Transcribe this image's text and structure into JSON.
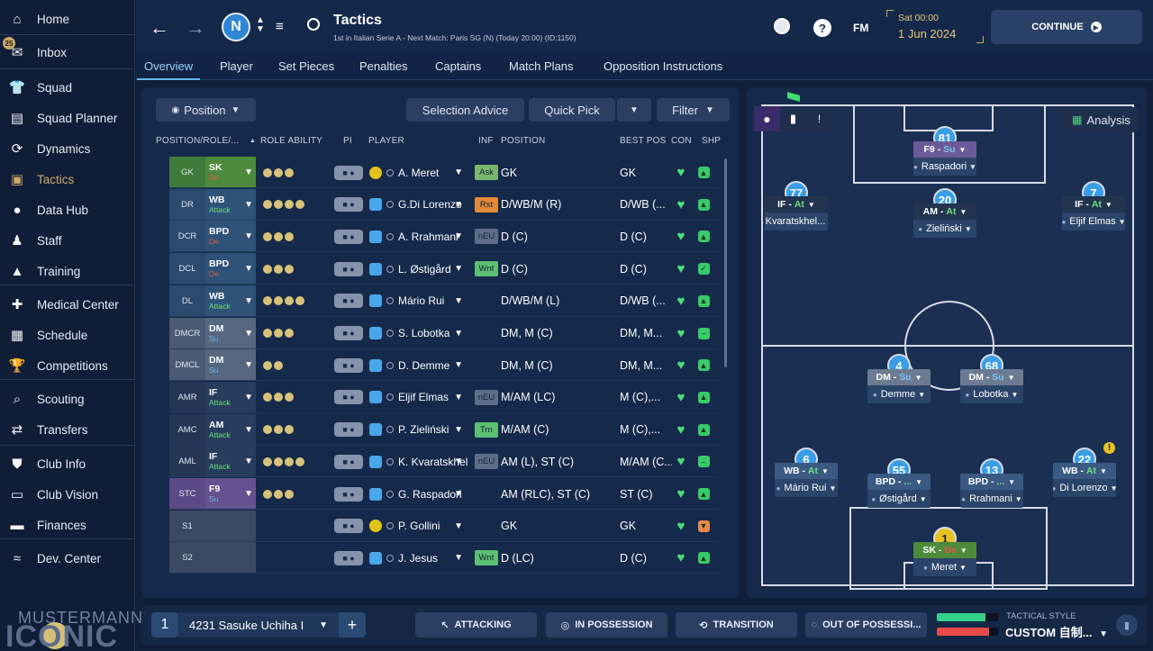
{
  "sidebar": {
    "items": [
      {
        "label": "Home",
        "icon": "home-icon"
      },
      {
        "label": "Inbox",
        "icon": "inbox-icon"
      },
      {
        "label": "Squad",
        "icon": "shirt-icon"
      },
      {
        "label": "Squad Planner",
        "icon": "clipboard-icon"
      },
      {
        "label": "Dynamics",
        "icon": "dynamics-icon"
      },
      {
        "label": "Tactics",
        "icon": "tactics-icon"
      },
      {
        "label": "Data Hub",
        "icon": "data-hub-icon"
      },
      {
        "label": "Staff",
        "icon": "staff-icon"
      },
      {
        "label": "Training",
        "icon": "training-icon"
      },
      {
        "label": "Medical Center",
        "icon": "medical-icon"
      },
      {
        "label": "Schedule",
        "icon": "calendar-icon"
      },
      {
        "label": "Competitions",
        "icon": "trophy-icon"
      },
      {
        "label": "Scouting",
        "icon": "search-icon"
      },
      {
        "label": "Transfers",
        "icon": "transfer-icon"
      },
      {
        "label": "Club Info",
        "icon": "shield-icon"
      },
      {
        "label": "Club Vision",
        "icon": "briefcase-icon"
      },
      {
        "label": "Finances",
        "icon": "money-icon"
      },
      {
        "label": "Dev. Center",
        "icon": "dev-center-icon"
      }
    ],
    "inbox_badge": "25",
    "brand_top": "MUSTERMANN",
    "brand_bottom": "ICONIC"
  },
  "header": {
    "title": "Tactics",
    "subtitle": "1st in Italian Serie A - Next Match: Paris SG (N) (Today 20:00) (ID:1150)",
    "menu_label": "FM",
    "day_time": "Sat 00:00",
    "date": "1 Jun 2024",
    "continue_label": "CONTINUE"
  },
  "tabs": [
    "Overview",
    "Player",
    "Set Pieces",
    "Penalties",
    "Captains",
    "Match Plans",
    "Opposition Instructions"
  ],
  "toolbar": {
    "position_label": "Position",
    "selection_advice": "Selection Advice",
    "quick_pick": "Quick Pick",
    "filter": "Filter",
    "analysis": "Analysis"
  },
  "columns": [
    "POSITION/ROLE/...",
    "ROLE ABILITY",
    "PI",
    "PLAYER",
    "INF",
    "POSITION",
    "BEST POS",
    "CON",
    "SHP"
  ],
  "rows": [
    {
      "pos": "GK",
      "role": "SK",
      "duty": "De",
      "dots": 3,
      "player": "A. Meret",
      "gk": true,
      "inf": "Ask",
      "infc": "#7ab86e",
      "position": "GK",
      "best": "GK",
      "shp": "up",
      "bg": "#3f7a3a",
      "rbg": "#4d8a3e"
    },
    {
      "pos": "DR",
      "role": "WB",
      "duty": "Attack",
      "dots": 4,
      "player": "G.Di Lorenzo",
      "gk": false,
      "inf": "Rst",
      "infc": "#e08a3a",
      "position": "D/WB/M (R)",
      "best": "D/WB (...",
      "shp": "up",
      "bg": "#2a4a6e",
      "rbg": "#2f5278"
    },
    {
      "pos": "DCR",
      "role": "BPD",
      "duty": "De",
      "dots": 3,
      "player": "A. Rrahmani",
      "gk": false,
      "inf": "nEU",
      "infc": "#5d6f88",
      "position": "D (C)",
      "best": "D (C)",
      "shp": "up",
      "bg": "#2a4a6e",
      "rbg": "#2f5278"
    },
    {
      "pos": "DCL",
      "role": "BPD",
      "duty": "De",
      "dots": 3,
      "player": "L. Østigård",
      "gk": false,
      "inf": "Wnt",
      "infc": "#5cbf74",
      "position": "D (C)",
      "best": "D (C)",
      "shp": "check",
      "bg": "#2a4a6e",
      "rbg": "#2f5278"
    },
    {
      "pos": "DL",
      "role": "WB",
      "duty": "Attack",
      "dots": 4,
      "player": "Mário Rui",
      "gk": false,
      "inf": "",
      "infc": "",
      "position": "D/WB/M (L)",
      "best": "D/WB (...",
      "shp": "up",
      "bg": "#2a4a6e",
      "rbg": "#2f5278"
    },
    {
      "pos": "DMCR",
      "role": "DM",
      "duty": "Su",
      "dots": 3,
      "player": "S. Lobotka",
      "gk": false,
      "inf": "",
      "infc": "",
      "position": "DM, M (C)",
      "best": "DM, M...",
      "shp": "flat",
      "bg": "#4a5a72",
      "rbg": "#566780"
    },
    {
      "pos": "DMCL",
      "role": "DM",
      "duty": "Su",
      "dots": 2,
      "player": "D. Demme",
      "gk": false,
      "inf": "",
      "infc": "",
      "position": "DM, M (C)",
      "best": "DM, M...",
      "shp": "up",
      "bg": "#4a5a72",
      "rbg": "#566780"
    },
    {
      "pos": "AMR",
      "role": "IF",
      "duty": "Attack",
      "dots": 3,
      "player": "Eljif Elmas",
      "gk": false,
      "inf": "nEU",
      "infc": "#5d6f88",
      "position": "M/AM (LC)",
      "best": "M (C),...",
      "shp": "up",
      "bg": "#243654",
      "rbg": "#283d5e"
    },
    {
      "pos": "AMC",
      "role": "AM",
      "duty": "Attack",
      "dots": 3,
      "player": "P. Zieliński",
      "gk": false,
      "inf": "Trn",
      "infc": "#5cbf74",
      "position": "M/AM (C)",
      "best": "M (C),...",
      "shp": "up",
      "bg": "#243654",
      "rbg": "#283d5e"
    },
    {
      "pos": "AML",
      "role": "IF",
      "duty": "Attack",
      "dots": 4,
      "player": "K. Kvaratskhel...",
      "gk": false,
      "inf": "nEU",
      "infc": "#5d6f88",
      "position": "AM (L), ST (C)",
      "best": "M/AM (C...",
      "shp": "flat",
      "bg": "#243654",
      "rbg": "#283d5e"
    },
    {
      "pos": "STC",
      "role": "F9",
      "duty": "Su",
      "dots": 3,
      "player": "G. Raspadori",
      "gk": false,
      "inf": "",
      "infc": "",
      "position": "AM (RLC), ST (C)",
      "best": "ST (C)",
      "shp": "up",
      "bg": "#5c4a86",
      "rbg": "#66528f"
    },
    {
      "pos": "S1",
      "role": "",
      "duty": "",
      "dots": 0,
      "player": "P. Gollini",
      "gk": true,
      "inf": "",
      "infc": "",
      "position": "GK",
      "best": "GK",
      "shp": "down",
      "bg": "#3a4a62",
      "rbg": "#3a4a62"
    },
    {
      "pos": "S2",
      "role": "",
      "duty": "",
      "dots": 0,
      "player": "J. Jesus",
      "gk": false,
      "inf": "Wnt",
      "infc": "#5cbf74",
      "position": "D (LC)",
      "best": "D (C)",
      "shp": "up",
      "bg": "#3a4a62",
      "rbg": "#3a4a62"
    }
  ],
  "pitch_players": [
    {
      "num": "81",
      "role": "F9",
      "duty": "Su",
      "name": "Raspadori",
      "color": "#6c5a98"
    },
    {
      "num": "77",
      "role": "IF",
      "duty": "At",
      "name": "Kvaratskhel...",
      "color": "#23344f"
    },
    {
      "num": "20",
      "role": "AM",
      "duty": "At",
      "name": "Zieliński",
      "color": "#23344f"
    },
    {
      "num": "7",
      "role": "IF",
      "duty": "At",
      "name": "Eljif Elmas",
      "color": "#23344f"
    },
    {
      "num": "4",
      "role": "DM",
      "duty": "Su",
      "name": "Demme",
      "color": "#6c7a92"
    },
    {
      "num": "68",
      "role": "DM",
      "duty": "Su",
      "name": "Lobotka",
      "color": "#6c7a92"
    },
    {
      "num": "6",
      "role": "WB",
      "duty": "At",
      "name": "Mário Rui",
      "color": "#3a5a84"
    },
    {
      "num": "55",
      "role": "BPD",
      "duty": "...",
      "name": "Østigård",
      "color": "#3a5a84"
    },
    {
      "num": "13",
      "role": "BPD",
      "duty": "...",
      "name": "Rrahmani",
      "color": "#3a5a84"
    },
    {
      "num": "22",
      "role": "WB",
      "duty": "At",
      "name": "Di Lorenzo",
      "color": "#3a5a84"
    },
    {
      "num": "1",
      "role": "SK",
      "duty": "De",
      "name": "Meret",
      "color": "#4e8a3c"
    }
  ],
  "bottom": {
    "tactic_slot": "1",
    "tactic_name": "4231 Sasuke Uchiha I",
    "attacking": "ATTACKING",
    "in_possession": "IN POSSESSION",
    "transition": "TRANSITION",
    "out_of_possession": "OUT OF POSSESSI...",
    "style_label": "TACTICAL STYLE",
    "style_value": "CUSTOM 自制...",
    "bar_pos": 0.8,
    "bar_neg": 0.85
  }
}
